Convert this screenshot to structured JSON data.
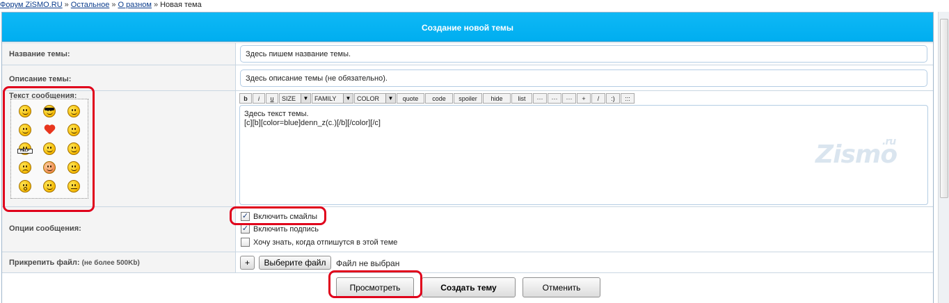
{
  "breadcrumb": {
    "items": [
      "Форум ZiSMO.RU",
      "Остальное",
      "О разном"
    ],
    "current": "Новая тема",
    "separator": "»"
  },
  "form": {
    "header": "Создание новой темы",
    "title_label": "Название темы:",
    "title_value": "Здесь пишем название темы.",
    "description_label": "Описание темы:",
    "description_value": "Здесь описание темы (не обязательно).",
    "message_label": "Текст сообщения:",
    "message_lines": [
      "Здесь текст темы.",
      "",
      "[c][b][color=blue]denn_z(c.)[/b][/color][/c]"
    ],
    "toolbar": [
      "b",
      "i",
      "u",
      "SIZE",
      "FAMILY",
      "COLOR",
      "quote",
      "code",
      "spoiler",
      "hide",
      "list",
      "···",
      "···",
      "···",
      "+",
      "/",
      ":)",
      ":::"
    ],
    "options_label": "Опции сообщения:",
    "options": [
      {
        "label": "Включить смайлы",
        "checked": true
      },
      {
        "label": "Включить подпись",
        "checked": true
      },
      {
        "label": "Хочу знать, когда отпишутся в этой теме",
        "checked": false
      }
    ],
    "attach_label": "Прикрепить файл:",
    "attach_limit": "(не более 500Kb)",
    "attach_plus": "+",
    "choose_file": "Выберите файл",
    "no_file": "Файл не выбран",
    "preview_button": "Просмотреть",
    "create_button": "Создать тему",
    "cancel_button": "Отменить"
  },
  "watermark": {
    "text": "Zismo",
    "suffix": ".ru"
  },
  "colors": {
    "header": "#00aef0",
    "highlight": "#e0001b",
    "link": "#0b3c8c"
  }
}
